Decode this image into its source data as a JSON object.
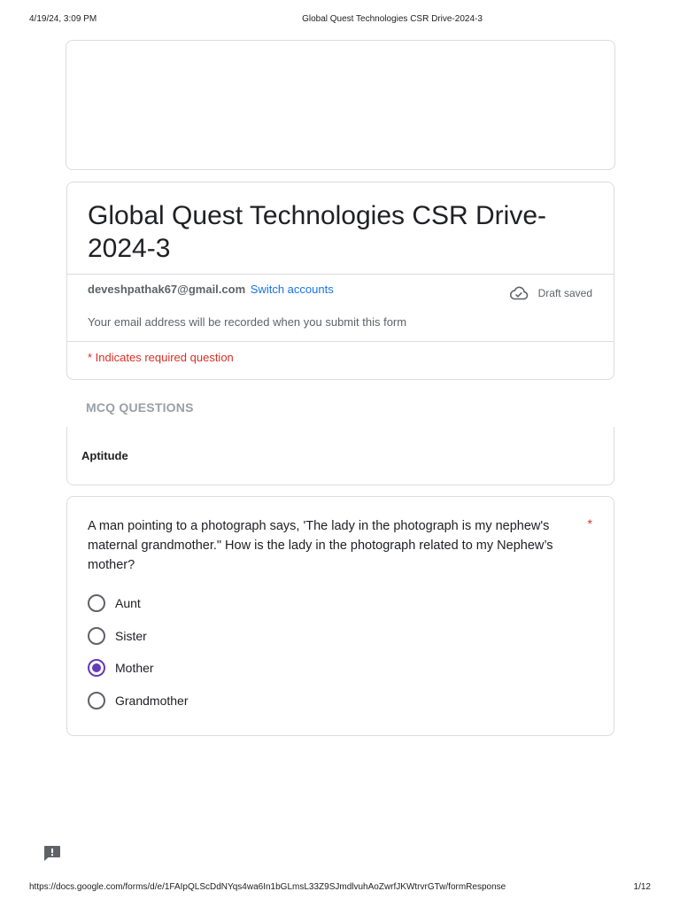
{
  "print_header": {
    "datetime": "4/19/24, 3:09 PM",
    "title": "Global Quest Technologies CSR Drive-2024-3"
  },
  "form": {
    "title": "Global Quest Technologies CSR Drive-2024-3",
    "account_email": "deveshpathak67@gmail.com",
    "switch_accounts": "Switch accounts",
    "draft_status": "Draft saved",
    "email_note": "Your email address will be recorded when you submit this form",
    "required_note": "* Indicates required question"
  },
  "section": {
    "title": "MCQ QUESTIONS",
    "subtitle": "Aptitude"
  },
  "question": {
    "text": "A man pointing to a photograph says, 'The lady in the photograph is my nephew's maternal grandmother.\" How is the lady in the photograph related to my Nephew’s mother?",
    "required_marker": "*",
    "options": [
      {
        "label": "Aunt",
        "selected": false
      },
      {
        "label": "Sister",
        "selected": false
      },
      {
        "label": "Mother",
        "selected": true
      },
      {
        "label": "Grandmother",
        "selected": false
      }
    ]
  },
  "print_footer": {
    "url": "https://docs.google.com/forms/d/e/1FAIpQLScDdNYqs4wa6In1bGLmsL33Z9SJmdlvuhAoZwrfJKWtrvrGTw/formResponse",
    "page": "1/12"
  },
  "colors": {
    "accent": "#673ab7",
    "link": "#1a73e8",
    "required": "#d93025"
  },
  "icons": {
    "draft": "cloud-check-icon",
    "feedback": "feedback-icon"
  }
}
